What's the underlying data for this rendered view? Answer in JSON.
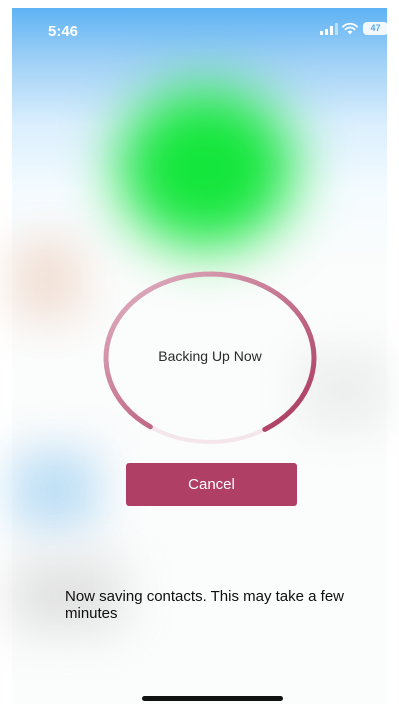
{
  "status_bar": {
    "time": "5:46",
    "battery": "47"
  },
  "backup": {
    "status_label": "Backing Up Now",
    "progress": 0.62
  },
  "actions": {
    "cancel_label": "Cancel"
  },
  "message": {
    "text": "Now saving contacts. This may take a few minutes"
  },
  "colors": {
    "accent": "#b03f66",
    "ring_light": "#e8c8d4",
    "green_blob": "#14e63c",
    "sky": "#5eb3f4"
  }
}
